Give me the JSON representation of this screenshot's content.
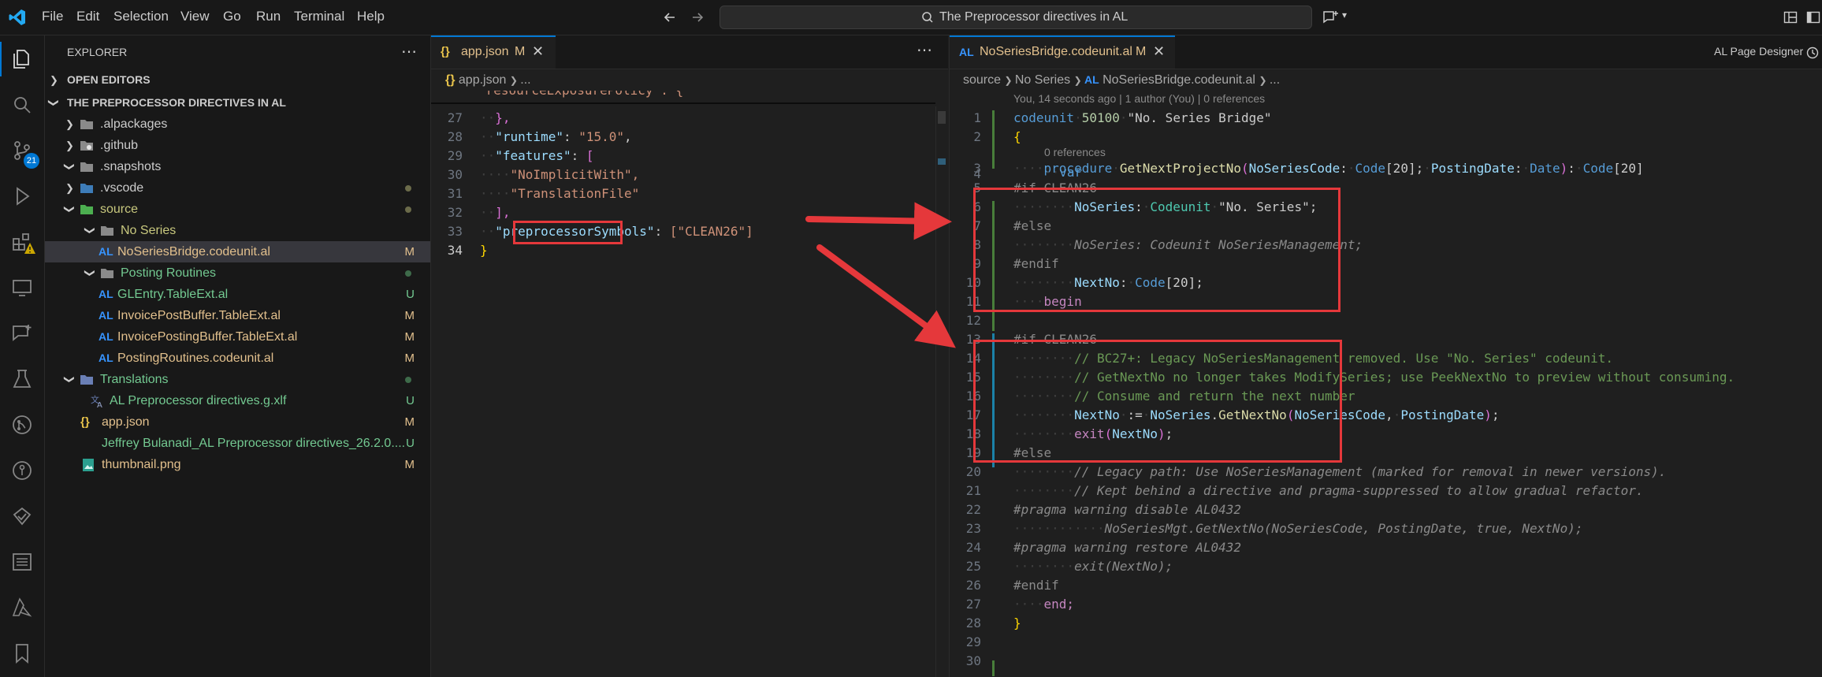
{
  "menu": [
    "File",
    "Edit",
    "Selection",
    "View",
    "Go",
    "Run",
    "Terminal",
    "Help"
  ],
  "command_center": "The Preprocessor directives in AL",
  "activity": {
    "source_control_badge": "21"
  },
  "explorer": {
    "title": "EXPLORER",
    "open_editors": "OPEN EDITORS",
    "workspace": "THE PREPROCESSOR DIRECTIVES IN AL",
    "items": [
      {
        "label": ".alpackages",
        "status": ""
      },
      {
        "label": ".github",
        "status": ""
      },
      {
        "label": ".snapshots",
        "status": ""
      },
      {
        "label": ".vscode",
        "status": "dot"
      },
      {
        "label": "source",
        "status": "dot"
      },
      {
        "label": "No Series",
        "status": ""
      },
      {
        "label": "NoSeriesBridge.codeunit.al",
        "status": "M"
      },
      {
        "label": "Posting Routines",
        "status": "dot"
      },
      {
        "label": "GLEntry.TableExt.al",
        "status": "U"
      },
      {
        "label": "InvoicePostBuffer.TableExt.al",
        "status": "M"
      },
      {
        "label": "InvoicePostingBuffer.TableExt.al",
        "status": "M"
      },
      {
        "label": "PostingRoutines.codeunit.al",
        "status": "M"
      },
      {
        "label": "Translations",
        "status": "dot"
      },
      {
        "label": "AL Preprocessor directives.g.xlf",
        "status": "U"
      },
      {
        "label": "app.json",
        "status": "M"
      },
      {
        "label": "Jeffrey Bulanadi_AL Preprocessor directives_26.2.0....",
        "status": "U"
      },
      {
        "label": "thumbnail.png",
        "status": "M"
      }
    ]
  },
  "left_editor": {
    "tab": {
      "label": "app.json",
      "status": "M"
    },
    "breadcrumb": [
      "app.json",
      "..."
    ],
    "lines": [
      {
        "n": "27",
        "text": "},"
      },
      {
        "n": "28",
        "key": "\"runtime\"",
        "value": "\"15.0\""
      },
      {
        "n": "29",
        "key": "\"features\"",
        "value": "["
      },
      {
        "n": "30",
        "value": "\"NoImplicitWith\","
      },
      {
        "n": "31",
        "value": "\"TranslationFile\""
      },
      {
        "n": "32",
        "text": "],"
      },
      {
        "n": "33",
        "key": "\"preprocessorSymbols\"",
        "value": "[\"CLEAN26\"]"
      },
      {
        "n": "34",
        "text": "}"
      }
    ]
  },
  "right_editor": {
    "tab": {
      "label": "NoSeriesBridge.codeunit.al",
      "status": "M"
    },
    "toolbar_label": "AL Page Designer",
    "breadcrumb": [
      "source",
      "No Series",
      "NoSeriesBridge.codeunit.al",
      "..."
    ],
    "blame": "You, 14 seconds ago | 1 author (You) | 0 references",
    "refs": "0 references",
    "line_numbers": [
      "1",
      "2",
      "3",
      "4",
      "5",
      "6",
      "7",
      "8",
      "9",
      "10",
      "11",
      "12",
      "13",
      "14",
      "15",
      "16",
      "17",
      "18",
      "19",
      "20",
      "21",
      "22",
      "23",
      "24",
      "25",
      "26",
      "27",
      "28",
      "29",
      "30"
    ],
    "code": {
      "l1_kw": "codeunit",
      "l1_num": "50100",
      "l1_name": "\"No. Series Bridge\"",
      "l2": "{",
      "l3_kw": "procedure",
      "l3_fn": "GetNextProjectNo",
      "l3_p1": "NoSeriesCode",
      "l3_t1": "Code",
      "l3_n1": "[20]",
      "l3_p2": "PostingDate",
      "l3_t2": "Date",
      "l3_t3": "Code",
      "l3_n3": "[20]",
      "l4": "var",
      "l5": "#if CLEAN26",
      "l6_var": "NoSeries",
      "l6_ty": "Codeunit",
      "l6_name": "\"No. Series\"",
      "l7": "#else",
      "l8": "NoSeries: Codeunit NoSeriesManagement;",
      "l9": "#endif",
      "l10_var": "NextNo",
      "l10_ty": "Code",
      "l10_n": "[20]",
      "l11": "begin",
      "l13": "#if CLEAN26",
      "l14": "// BC27+: Legacy NoSeriesManagement removed. Use \"No. Series\" codeunit.",
      "l15": "// GetNextNo no longer takes ModifySeries; use PeekNextNo to preview without consuming.",
      "l16": "// Consume and return the next number",
      "l17_a": "NextNo",
      "l17_b": "NoSeries",
      "l17_fn": "GetNextNo",
      "l17_c": "NoSeriesCode",
      "l17_d": "PostingDate",
      "l18_kw": "exit",
      "l18_v": "NextNo",
      "l19": "#else",
      "l20": "// Legacy path: Use NoSeriesManagement (marked for removal in newer versions).",
      "l21": "// Kept behind a directive and pragma-suppressed to allow gradual refactor.",
      "l22": "#pragma warning disable AL0432",
      "l23": "NoSeriesMgt.GetNextNo(NoSeriesCode, PostingDate, true, NextNo);",
      "l24": "#pragma warning restore AL0432",
      "l25": "exit(NextNo);",
      "l26": "#endif",
      "l27": "end;",
      "l28": "}"
    }
  },
  "colors": {
    "accent": "#0078d4",
    "annotation": "#e5383b"
  }
}
